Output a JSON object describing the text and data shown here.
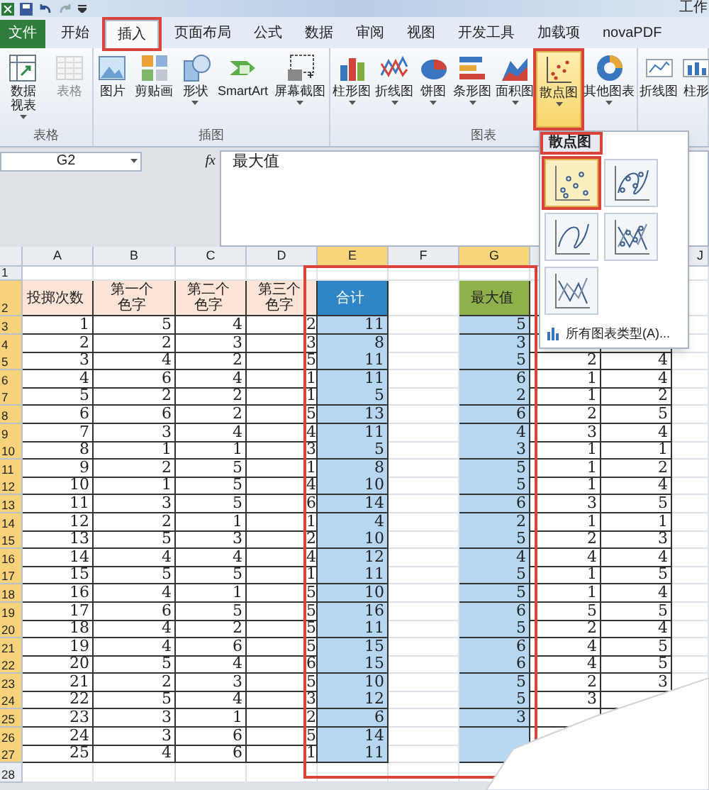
{
  "title_bar": {
    "title": "工作"
  },
  "tabs": [
    {
      "label": "文件",
      "kind": "file",
      "selected": false,
      "annotated": false
    },
    {
      "label": "开始",
      "kind": "tab",
      "selected": false,
      "annotated": false
    },
    {
      "label": "插入",
      "kind": "tab",
      "selected": true,
      "annotated": true
    },
    {
      "label": "页面布局",
      "kind": "tab",
      "selected": false,
      "annotated": false
    },
    {
      "label": "公式",
      "kind": "tab",
      "selected": false,
      "annotated": false
    },
    {
      "label": "数据",
      "kind": "tab",
      "selected": false,
      "annotated": false
    },
    {
      "label": "审阅",
      "kind": "tab",
      "selected": false,
      "annotated": false
    },
    {
      "label": "视图",
      "kind": "tab",
      "selected": false,
      "annotated": false
    },
    {
      "label": "开发工具",
      "kind": "tab",
      "selected": false,
      "annotated": false
    },
    {
      "label": "加载项",
      "kind": "tab",
      "selected": false,
      "annotated": false
    },
    {
      "label": "novaPDF",
      "kind": "tab",
      "selected": false,
      "annotated": false
    }
  ],
  "ribbon": {
    "groups": [
      {
        "label": "表格",
        "items": [
          {
            "lines": [
              "数据",
              "视表"
            ],
            "dropdown": true,
            "disabled": false,
            "selected": false,
            "annotated": false
          },
          {
            "lines": [
              "表格"
            ],
            "dropdown": false,
            "disabled": true,
            "selected": false,
            "annotated": false
          }
        ]
      },
      {
        "label": "插图",
        "items": [
          {
            "lines": [
              "图片"
            ],
            "dropdown": false,
            "disabled": false,
            "selected": false,
            "annotated": false
          },
          {
            "lines": [
              "剪贴画"
            ],
            "dropdown": false,
            "disabled": false,
            "selected": false,
            "annotated": false
          },
          {
            "lines": [
              "形状"
            ],
            "dropdown": true,
            "disabled": false,
            "selected": false,
            "annotated": false
          },
          {
            "lines": [
              "SmartArt"
            ],
            "dropdown": false,
            "disabled": false,
            "selected": false,
            "annotated": false
          },
          {
            "lines": [
              "屏幕截图"
            ],
            "dropdown": true,
            "disabled": false,
            "selected": false,
            "annotated": false
          }
        ]
      },
      {
        "label": "图表",
        "items": [
          {
            "lines": [
              "柱形图"
            ],
            "dropdown": true,
            "disabled": false,
            "selected": false,
            "annotated": false
          },
          {
            "lines": [
              "折线图"
            ],
            "dropdown": true,
            "disabled": false,
            "selected": false,
            "annotated": false
          },
          {
            "lines": [
              "饼图"
            ],
            "dropdown": true,
            "disabled": false,
            "selected": false,
            "annotated": false
          },
          {
            "lines": [
              "条形图"
            ],
            "dropdown": true,
            "disabled": false,
            "selected": false,
            "annotated": false
          },
          {
            "lines": [
              "面积图"
            ],
            "dropdown": true,
            "disabled": false,
            "selected": false,
            "annotated": false
          },
          {
            "lines": [
              "散点图"
            ],
            "dropdown": true,
            "disabled": false,
            "selected": true,
            "annotated": true
          },
          {
            "lines": [
              "其他图表"
            ],
            "dropdown": true,
            "disabled": false,
            "selected": false,
            "annotated": false
          }
        ]
      },
      {
        "items": [
          {
            "lines": [
              "折线图"
            ],
            "dropdown": false,
            "disabled": false,
            "selected": false,
            "annotated": false
          },
          {
            "lines": [
              "柱形"
            ],
            "dropdown": false,
            "disabled": false,
            "selected": false,
            "annotated": false
          }
        ]
      }
    ]
  },
  "formula_bar": {
    "name_box": "G2",
    "function_label": "fx",
    "content": "最大值"
  },
  "scatter_menu": {
    "title": "散点图",
    "title_annotated": true,
    "options": [
      {
        "kind": "markers",
        "selected": true,
        "annotated": true
      },
      {
        "kind": "smooth-markers",
        "selected": false,
        "annotated": false
      },
      {
        "kind": "smooth",
        "selected": false,
        "annotated": false
      },
      {
        "kind": "straight-markers",
        "selected": false,
        "annotated": false
      },
      {
        "kind": "straight",
        "selected": false,
        "annotated": false
      }
    ],
    "footer": "所有图表类型(A)..."
  },
  "sheet": {
    "selection_annotated": true,
    "column_headers": [
      {
        "label": "A",
        "highlighted": false
      },
      {
        "label": "B",
        "highlighted": false
      },
      {
        "label": "C",
        "highlighted": false
      },
      {
        "label": "D",
        "highlighted": false
      },
      {
        "label": "E",
        "highlighted": true
      },
      {
        "label": "F",
        "highlighted": false
      },
      {
        "label": "G",
        "highlighted": true
      },
      {
        "label": "J",
        "highlighted": false
      }
    ],
    "rows": [
      {
        "row": "1",
        "highlighted": false
      },
      {
        "row": "2",
        "highlighted": true,
        "header_cells": [
          {
            "lines": [
              "投掷次数"
            ],
            "color": "#fce4d6"
          },
          {
            "lines": [
              "第一个",
              "色字"
            ],
            "color": "#fce4d6"
          },
          {
            "lines": [
              "第二个",
              "色字"
            ],
            "color": "#fce4d6"
          },
          {
            "lines": [
              "第三个",
              "色字"
            ],
            "color": "#fce4d6"
          },
          {
            "lines": [
              "合计"
            ],
            "color": "#2f86c6"
          },
          null,
          {
            "lines": [
              "最大值"
            ],
            "color": "#8fb04a"
          }
        ]
      },
      {
        "row": "3",
        "highlighted": true,
        "cells": [
          "1",
          "5",
          "4",
          "2",
          "11",
          null,
          "5",
          null,
          null
        ]
      },
      {
        "row": "4",
        "highlighted": true,
        "cells": [
          "2",
          "2",
          "3",
          "3",
          "8",
          null,
          "3",
          null,
          null
        ]
      },
      {
        "row": "5",
        "highlighted": true,
        "cells": [
          "3",
          "4",
          "2",
          "5",
          "11",
          null,
          "5",
          "2",
          "4"
        ]
      },
      {
        "row": "6",
        "highlighted": true,
        "cells": [
          "4",
          "6",
          "4",
          "1",
          "11",
          null,
          "6",
          "1",
          "4"
        ]
      },
      {
        "row": "7",
        "highlighted": true,
        "cells": [
          "5",
          "2",
          "2",
          "1",
          "5",
          null,
          "2",
          "1",
          "2"
        ]
      },
      {
        "row": "8",
        "highlighted": true,
        "cells": [
          "6",
          "6",
          "2",
          "5",
          "13",
          null,
          "6",
          "2",
          "5"
        ]
      },
      {
        "row": "9",
        "highlighted": true,
        "cells": [
          "7",
          "3",
          "4",
          "4",
          "11",
          null,
          "4",
          "3",
          "4"
        ]
      },
      {
        "row": "10",
        "highlighted": true,
        "cells": [
          "8",
          "1",
          "1",
          "3",
          "5",
          null,
          "3",
          "1",
          "1"
        ]
      },
      {
        "row": "11",
        "highlighted": true,
        "cells": [
          "9",
          "2",
          "5",
          "1",
          "8",
          null,
          "5",
          "1",
          "2"
        ]
      },
      {
        "row": "12",
        "highlighted": true,
        "cells": [
          "10",
          "1",
          "5",
          "4",
          "10",
          null,
          "5",
          "1",
          "4"
        ]
      },
      {
        "row": "13",
        "highlighted": true,
        "cells": [
          "11",
          "3",
          "5",
          "6",
          "14",
          null,
          "6",
          "3",
          "5"
        ]
      },
      {
        "row": "14",
        "highlighted": true,
        "cells": [
          "12",
          "2",
          "1",
          "1",
          "4",
          null,
          "2",
          "1",
          "1"
        ]
      },
      {
        "row": "15",
        "highlighted": true,
        "cells": [
          "13",
          "5",
          "3",
          "2",
          "10",
          null,
          "5",
          "2",
          "3"
        ]
      },
      {
        "row": "16",
        "highlighted": true,
        "cells": [
          "14",
          "4",
          "4",
          "4",
          "12",
          null,
          "4",
          "4",
          "4"
        ]
      },
      {
        "row": "17",
        "highlighted": true,
        "cells": [
          "15",
          "5",
          "5",
          "1",
          "11",
          null,
          "5",
          "1",
          "5"
        ]
      },
      {
        "row": "18",
        "highlighted": true,
        "cells": [
          "16",
          "4",
          "1",
          "5",
          "10",
          null,
          "5",
          "1",
          "4"
        ]
      },
      {
        "row": "19",
        "highlighted": true,
        "cells": [
          "17",
          "6",
          "5",
          "5",
          "16",
          null,
          "6",
          "5",
          "5"
        ]
      },
      {
        "row": "20",
        "highlighted": true,
        "cells": [
          "18",
          "4",
          "2",
          "5",
          "11",
          null,
          "5",
          "2",
          "4"
        ]
      },
      {
        "row": "21",
        "highlighted": true,
        "cells": [
          "19",
          "4",
          "6",
          "5",
          "15",
          null,
          "6",
          "4",
          "5"
        ]
      },
      {
        "row": "22",
        "highlighted": true,
        "cells": [
          "20",
          "5",
          "4",
          "6",
          "15",
          null,
          "6",
          "4",
          "5"
        ]
      },
      {
        "row": "23",
        "highlighted": true,
        "cells": [
          "21",
          "2",
          "3",
          "5",
          "10",
          null,
          "5",
          "2",
          "3"
        ]
      },
      {
        "row": "24",
        "highlighted": true,
        "cells": [
          "22",
          "5",
          "4",
          "3",
          "12",
          null,
          "5",
          "3",
          null
        ]
      },
      {
        "row": "25",
        "highlighted": true,
        "cells": [
          "23",
          "3",
          "1",
          "2",
          "6",
          null,
          "3",
          null,
          null
        ]
      },
      {
        "row": "26",
        "highlighted": true,
        "cells": [
          "24",
          "3",
          "6",
          "5",
          "14",
          null,
          null,
          null,
          null
        ]
      },
      {
        "row": "27",
        "highlighted": true,
        "cells": [
          "25",
          "4",
          "6",
          "1",
          "11",
          null,
          null,
          null,
          null
        ]
      },
      {
        "row": "28",
        "highlighted": false
      }
    ]
  }
}
